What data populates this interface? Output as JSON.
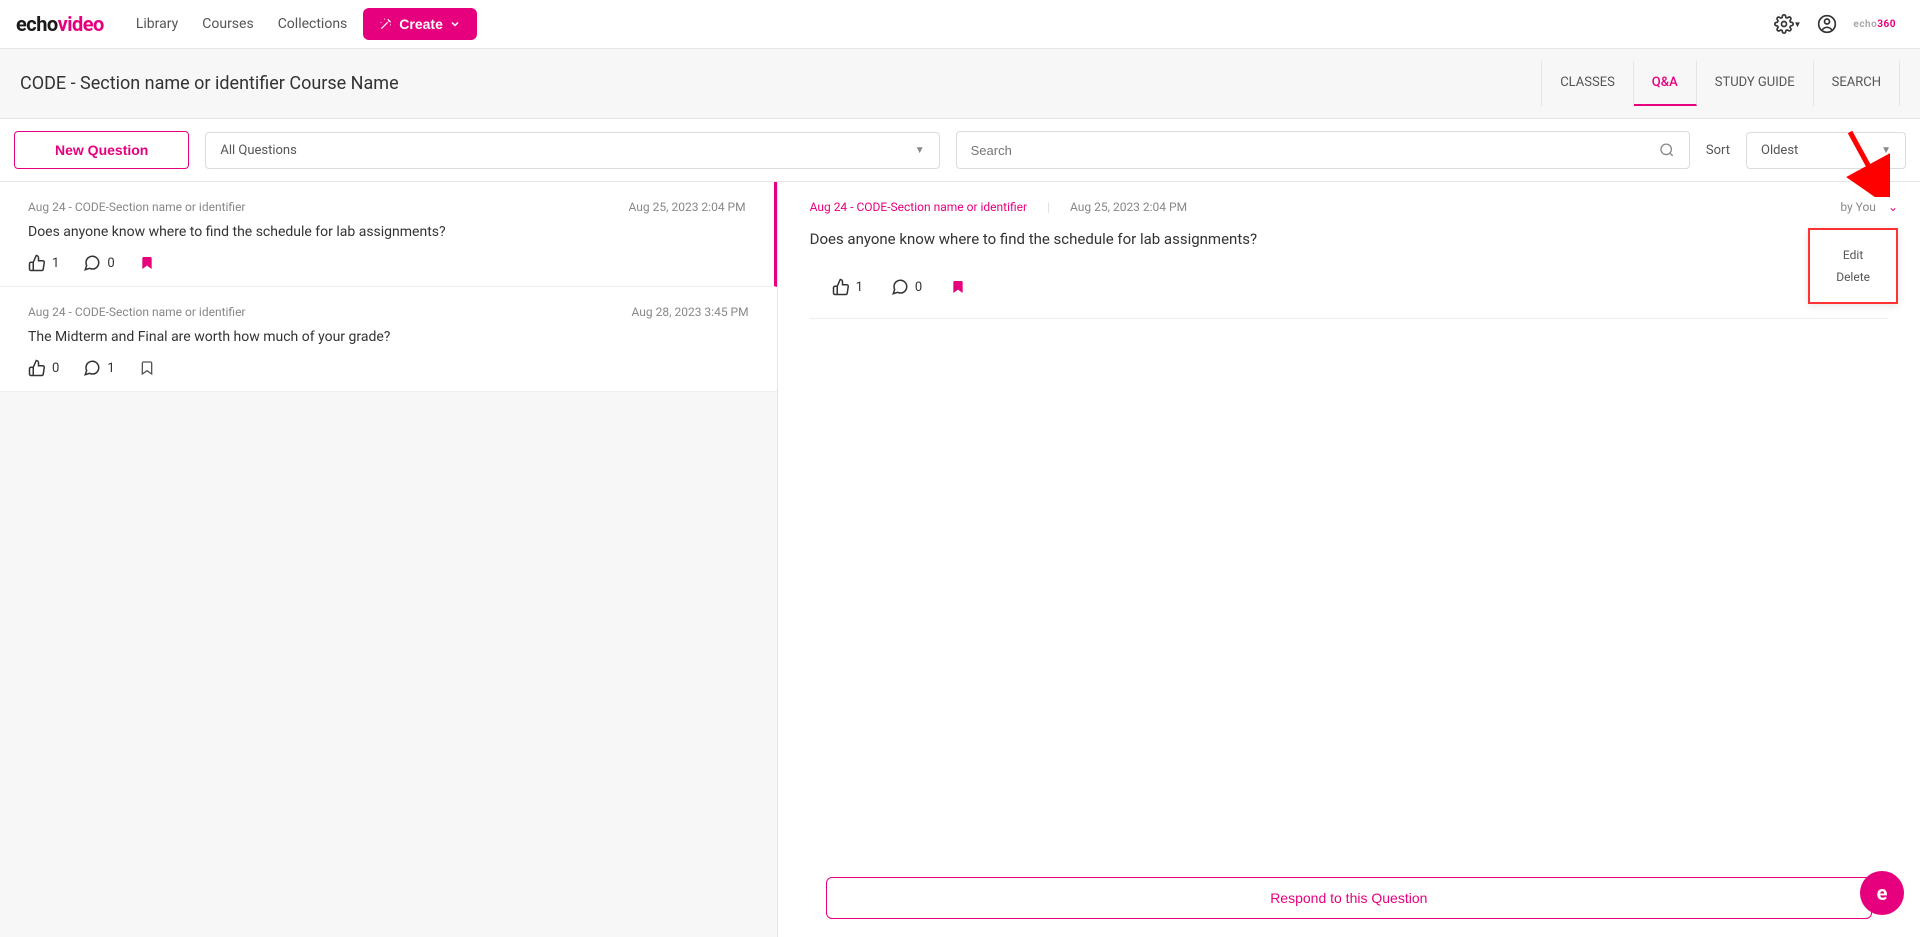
{
  "logo": {
    "part1": "echo",
    "part2": "video"
  },
  "nav": {
    "library": "Library",
    "courses": "Courses",
    "collections": "Collections",
    "create": "Create"
  },
  "smallLogo": {
    "part1": "echo",
    "part2": "360"
  },
  "course": {
    "title": "CODE - Section name or identifier Course Name"
  },
  "tabs": {
    "classes": "CLASSES",
    "qa": "Q&A",
    "studyGuide": "STUDY GUIDE",
    "search": "SEARCH"
  },
  "toolbar": {
    "newQuestion": "New Question",
    "filterLabel": "All Questions",
    "searchPlaceholder": "Search",
    "sortLabel": "Sort",
    "sortValue": "Oldest"
  },
  "questions": [
    {
      "meta": "Aug 24 - CODE-Section name or identifier",
      "date": "Aug 25, 2023 2:04 PM",
      "text": "Does anyone know where to find the schedule for lab assignments?",
      "likes": "1",
      "comments": "0",
      "bookmarked": true
    },
    {
      "meta": "Aug 24 - CODE-Section name or identifier",
      "date": "Aug 28, 2023 3:45 PM",
      "text": "The Midterm and Final are worth how much of your grade?",
      "likes": "0",
      "comments": "1",
      "bookmarked": false
    }
  ],
  "detail": {
    "link": "Aug 24 - CODE-Section name or identifier",
    "date": "Aug 25, 2023 2:04 PM",
    "author": "by You",
    "text": "Does anyone know where to find the schedule for lab assignments?",
    "likes": "1",
    "comments": "0",
    "menu": {
      "edit": "Edit",
      "delete": "Delete"
    }
  },
  "respond": {
    "label": "Respond to this Question"
  },
  "fab": {
    "label": "e"
  }
}
